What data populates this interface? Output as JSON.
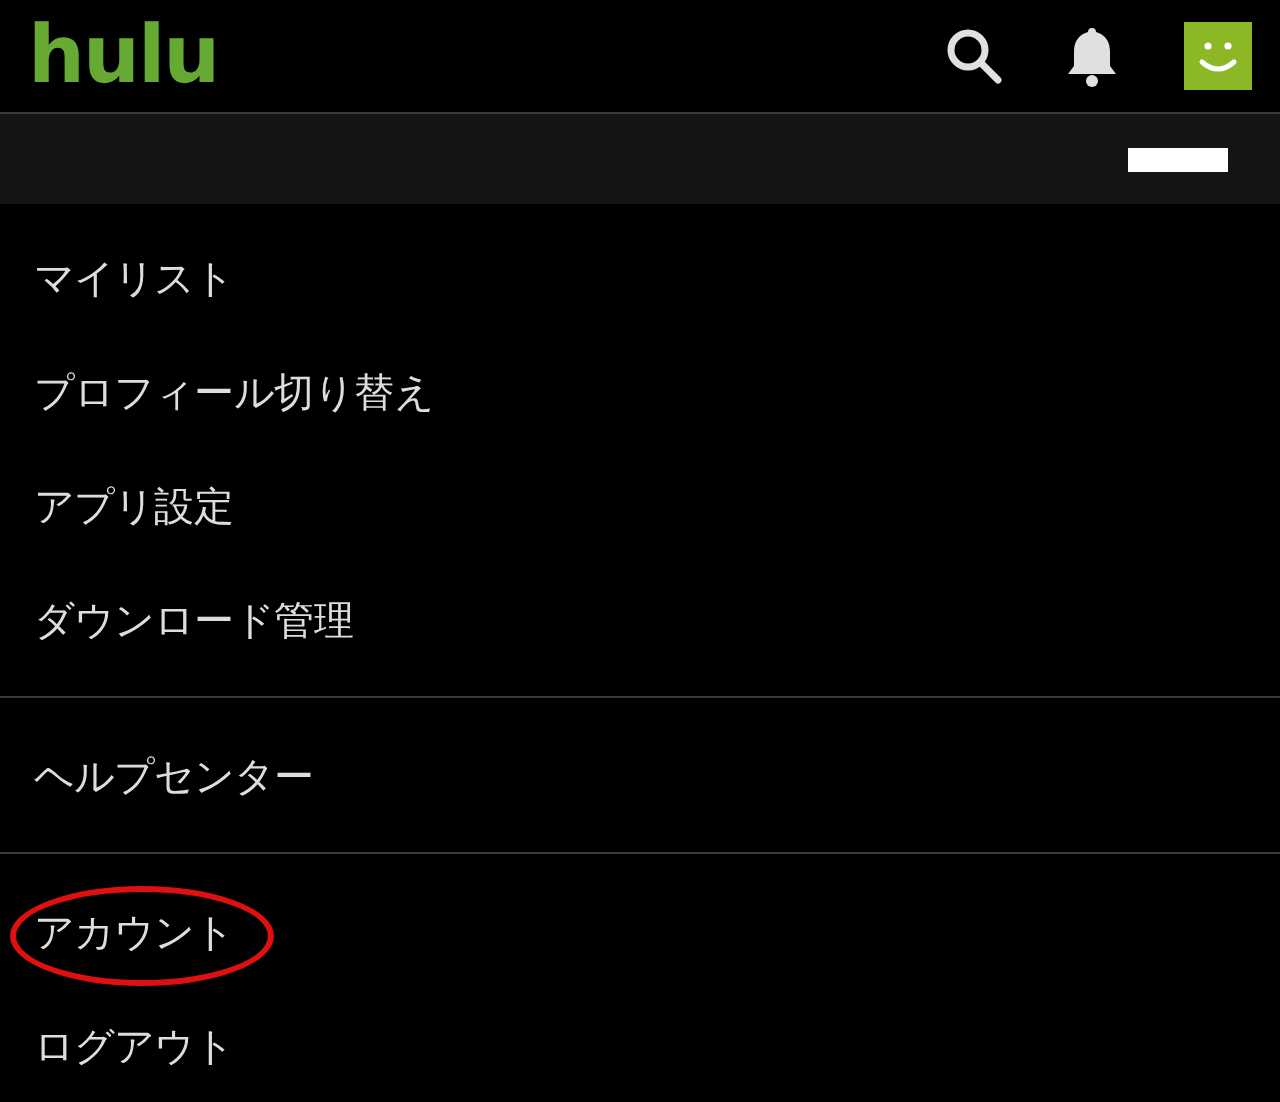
{
  "header": {
    "logo": "hulu"
  },
  "profile_bar": {
    "redacted": true
  },
  "menu_groups": [
    {
      "items": [
        {
          "label": "マイリスト",
          "circled": false
        },
        {
          "label": "プロフィール切り替え",
          "circled": false
        },
        {
          "label": "アプリ設定",
          "circled": false
        },
        {
          "label": "ダウンロード管理",
          "circled": false
        }
      ]
    },
    {
      "items": [
        {
          "label": "ヘルプセンター",
          "circled": false
        }
      ]
    },
    {
      "items": [
        {
          "label": "アカウント",
          "circled": true
        },
        {
          "label": "ログアウト",
          "circled": false
        }
      ]
    }
  ]
}
